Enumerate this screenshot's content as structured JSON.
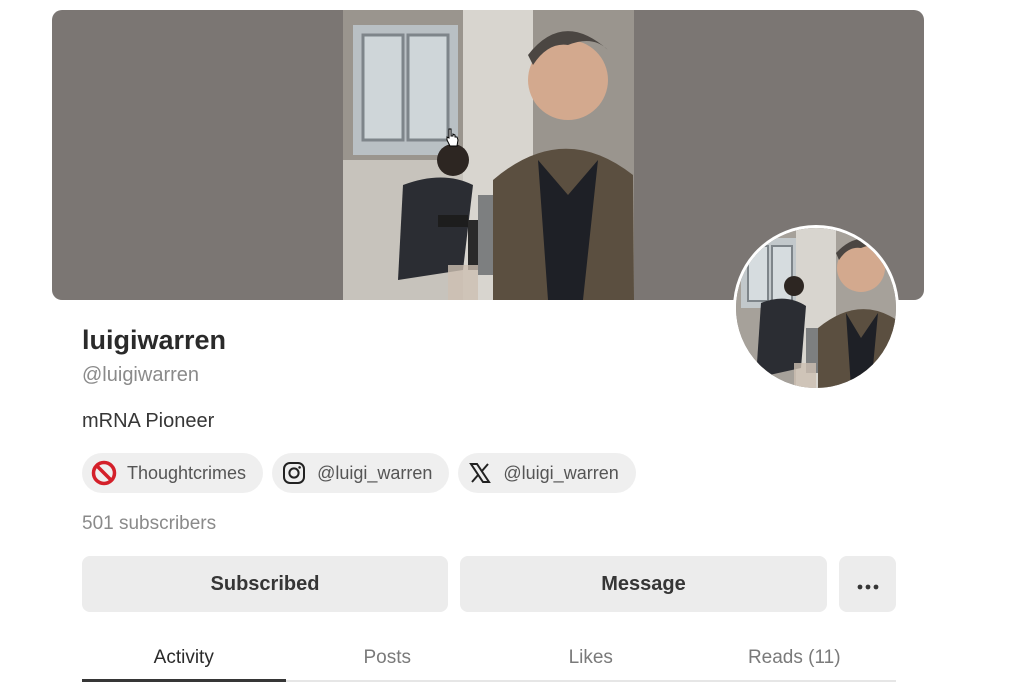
{
  "profile": {
    "name": "luigiwarren",
    "handle": "@luigiwarren",
    "bio": "mRNA Pioneer",
    "subscribers": "501 subscribers"
  },
  "links": [
    {
      "label": "Thoughtcrimes",
      "icon": "no-entry-icon"
    },
    {
      "label": "@luigi_warren",
      "icon": "instagram-icon"
    },
    {
      "label": "@luigi_warren",
      "icon": "x-logo-icon"
    }
  ],
  "actions": {
    "subscribed_label": "Subscribed",
    "message_label": "Message",
    "more_icon": "more-horizontal-icon"
  },
  "tabs": [
    {
      "label": "Activity",
      "active": true
    },
    {
      "label": "Posts",
      "active": false
    },
    {
      "label": "Likes",
      "active": false
    },
    {
      "label": "Reads (11)",
      "active": false
    }
  ],
  "colors": {
    "banner_bg": "#7b7673",
    "button_bg": "#ececec",
    "no_entry_red": "#d4202a"
  }
}
